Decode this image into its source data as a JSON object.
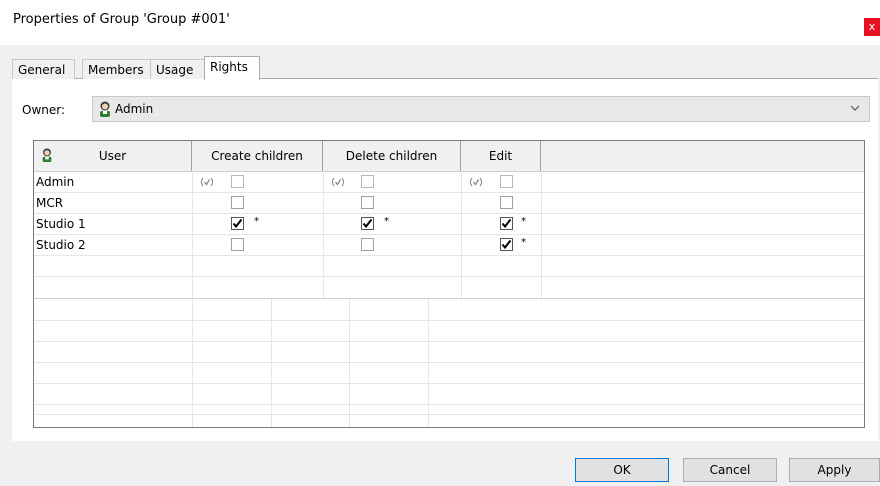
{
  "window": {
    "title": "Properties of Group 'Group #001'",
    "close_label": "x"
  },
  "tabs": [
    {
      "label": "General"
    },
    {
      "label": "Members"
    },
    {
      "label": "Usage"
    },
    {
      "label": "Rights"
    }
  ],
  "owner": {
    "label": "Owner:",
    "value": "Admin"
  },
  "grid": {
    "columns": [
      "User",
      "Create children",
      "Delete children",
      "Edit"
    ],
    "rows": [
      {
        "user": "Admin",
        "create": "inherited",
        "delete": "inherited",
        "edit": "inherited"
      },
      {
        "user": "MCR",
        "create": "unchecked",
        "delete": "unchecked",
        "edit": "unchecked"
      },
      {
        "user": "Studio 1",
        "create": "checked",
        "delete": "checked",
        "edit": "checked"
      },
      {
        "user": "Studio 2",
        "create": "unchecked",
        "delete": "unchecked",
        "edit": "checked"
      }
    ],
    "mark": "*"
  },
  "buttons": {
    "ok": "OK",
    "cancel": "Cancel",
    "apply": "Apply"
  },
  "colors": {
    "close_bg": "#e81123",
    "default_border": "#0078d7"
  }
}
